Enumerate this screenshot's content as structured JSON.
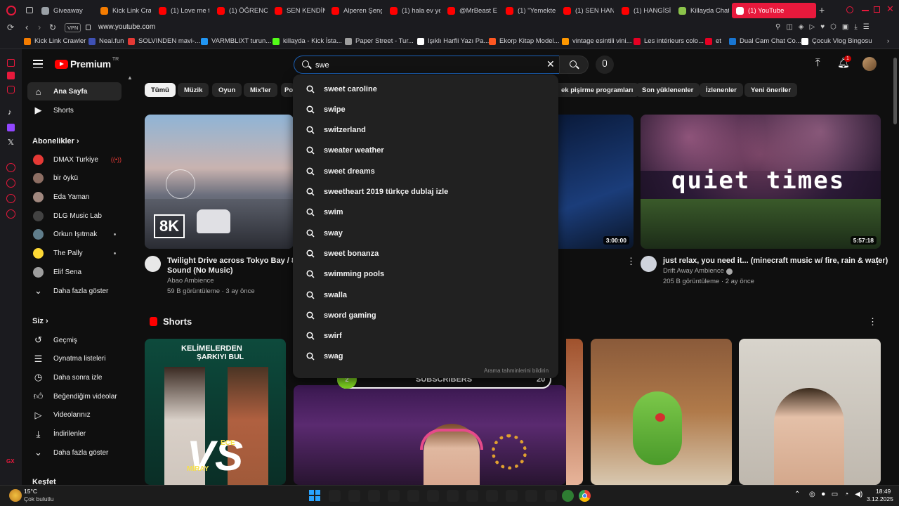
{
  "browser": {
    "tabs": [
      {
        "label": "Giveaway",
        "color": "#9aa0a6"
      },
      {
        "label": "Kick Link Cra",
        "color": "#f57c00"
      },
      {
        "label": "(1) Love me t",
        "color": "#ff0000"
      },
      {
        "label": "(1) ÖĞRENCİ",
        "color": "#ff0000"
      },
      {
        "label": "SEN KENDİNİ",
        "color": "#ff0000"
      },
      {
        "label": "Alperen Şeng",
        "color": "#ff0000"
      },
      {
        "label": "(1) hala ev ye",
        "color": "#ff0000"
      },
      {
        "label": "@MrBeast E",
        "color": "#ff0000"
      },
      {
        "label": "(1) \"Yemekte",
        "color": "#ff0000"
      },
      {
        "label": "(1) SEN HAN",
        "color": "#ff0000"
      },
      {
        "label": "(1) HANGİSİ",
        "color": "#ff0000"
      },
      {
        "label": "Killayda Chat",
        "color": "#8bc34a"
      },
      {
        "label": "(1) YouTube",
        "color": "#ffffff"
      }
    ],
    "vpn_label": "VPN",
    "url": "www.youtube.com",
    "bookmarks": [
      {
        "label": "Kick Link Crawler",
        "color": "#f57c00"
      },
      {
        "label": "Neal.fun",
        "color": "#3f51b5"
      },
      {
        "label": "SOLVINDEN mavi-...",
        "color": "#e53935"
      },
      {
        "label": "VARMBLIXT turun...",
        "color": "#2196f3"
      },
      {
        "label": "killayda - Kick İsta...",
        "color": "#53fc18"
      },
      {
        "label": "Paper Street - Tur...",
        "color": "#9e9e9e"
      },
      {
        "label": "Işıklı Harfli Yazı Pa...",
        "color": "#ffffff"
      },
      {
        "label": "Ekorp Kitap Model...",
        "color": "#ff5722"
      },
      {
        "label": "vintage esintili vini...",
        "color": "#ff9800"
      },
      {
        "label": "Les intérieurs colo...",
        "color": "#e60023"
      },
      {
        "label": "et",
        "color": "#e60023"
      },
      {
        "label": "Dual Cam Chat Co...",
        "color": "#1976d2"
      },
      {
        "label": "Çocuk Vlog Bingosu",
        "color": "#ffffff"
      }
    ]
  },
  "youtube": {
    "logo": "Premium",
    "logo_region": "TR",
    "search": {
      "value": "swe",
      "placeholder": "Ara"
    },
    "notification_count": "1",
    "sidebar": {
      "home": "Ana Sayfa",
      "shorts": "Shorts",
      "subscriptions_header": "Abonelikler",
      "subscriptions": [
        {
          "label": "DMAX Turkiye",
          "color": "#e53935"
        },
        {
          "label": "bir öykü",
          "color": "#8d6e63"
        },
        {
          "label": "Eda Yaman",
          "color": "#a1887f"
        },
        {
          "label": "DLG Music Lab",
          "color": "#424242"
        },
        {
          "label": "Orkun Işıtmak",
          "color": "#607d8b"
        },
        {
          "label": "The Pally",
          "color": "#fdd835"
        },
        {
          "label": "Elif Sena",
          "color": "#9e9e9e"
        }
      ],
      "show_more": "Daha fazla göster",
      "you_header": "Siz",
      "you_items": [
        {
          "label": "Geçmiş",
          "icon": "history-icon"
        },
        {
          "label": "Oynatma listeleri",
          "icon": "playlists-icon"
        },
        {
          "label": "Daha sonra izle",
          "icon": "watch-later-icon"
        },
        {
          "label": "Beğendiğim videolar",
          "icon": "like-icon"
        },
        {
          "label": "Videolarınız",
          "icon": "your-videos-icon"
        },
        {
          "label": "İndirilenler",
          "icon": "download-icon"
        }
      ],
      "show_more_2": "Daha fazla göster",
      "explore_header": "Keşfet"
    },
    "chips": {
      "first": [
        "Tümü",
        "Müzik",
        "Oyun",
        "Mix'ler",
        "Po"
      ],
      "last": [
        "ek pişirme programları",
        "Son yüklenenler",
        "İzlenenler",
        "Yeni öneriler"
      ]
    },
    "videos": [
      {
        "title_line1": "Twilight Drive across Tokyo Bay / 8K (",
        "title_line2": "Sound (No Music)",
        "channel": "Abao Ambience",
        "meta": "59 B görüntüleme · 3 ay önce",
        "badge": "8K"
      },
      {
        "duration": "3:00:00"
      },
      {
        "title_line1": "just relax, you need it... (minecraft music w/ fire, rain & water)",
        "channel": "Drift Away Ambience",
        "meta": "205 B görüntüleme · 2 ay önce",
        "duration": "5:57:18",
        "overlay": "quiet times"
      }
    ],
    "shorts_header": "Shorts",
    "shorts": [
      {
        "top": "KELİMELERDEN",
        "mid": "ŞARKIYI BUL",
        "vs": "VS",
        "name1": "ECE",
        "name2": "MİRAY"
      }
    ],
    "suggestions": [
      "sweet caroline",
      "swipe",
      "switzerland",
      "sweater weather",
      "sweet dreams",
      "sweetheart 2019 türkçe dublaj izle",
      "swim",
      "sway",
      "sweet bonanza",
      "swimming pools",
      "swalla",
      "sword gaming",
      "swirf",
      "swag"
    ],
    "suggest_report": "Arama tahminlerini bildirin",
    "sub_widget": {
      "left": "2",
      "label": "SUBSCRIBERS",
      "count": "20"
    }
  },
  "taskbar": {
    "temp": "15°C",
    "weather": "Çok bulutlu",
    "time": "18:49",
    "date": "3.12.2025"
  }
}
